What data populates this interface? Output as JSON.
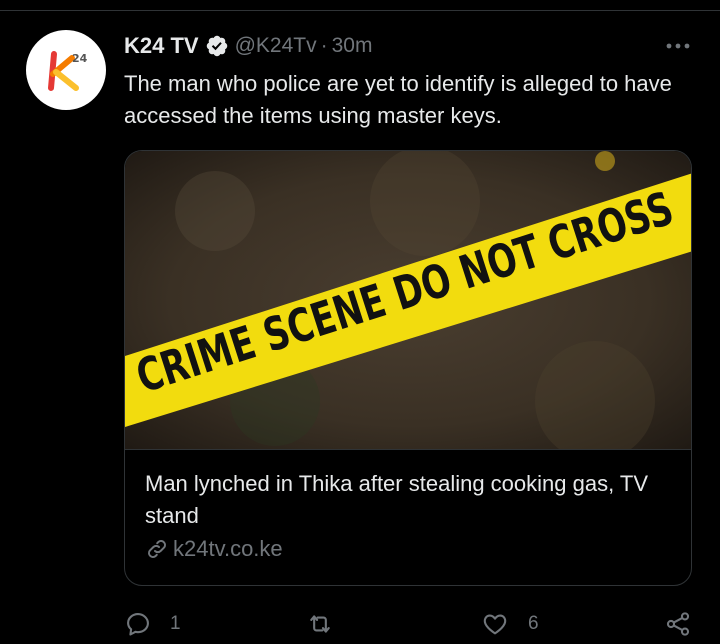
{
  "tweet": {
    "display_name": "K24 TV",
    "handle": "@K24Tv",
    "separator": "·",
    "time": "30m",
    "text": "The man who police are yet to identify is alleged to have accessed the items using master keys.",
    "avatar_logo": "K24 logo",
    "verified_icon": "verified-badge-icon"
  },
  "card": {
    "image_text": "CRIME SCENE DO NOT CROSS",
    "title": "Man lynched in Thika after stealing cooking gas, TV stand",
    "domain": "k24tv.co.ke"
  },
  "actions": {
    "reply_count": "1",
    "retweet_count": "",
    "like_count": "6"
  },
  "colors": {
    "background": "#000000",
    "text": "#e7e9ea",
    "muted": "#71767b",
    "border": "#2f3336",
    "tape_yellow": "#f2dc0e"
  }
}
